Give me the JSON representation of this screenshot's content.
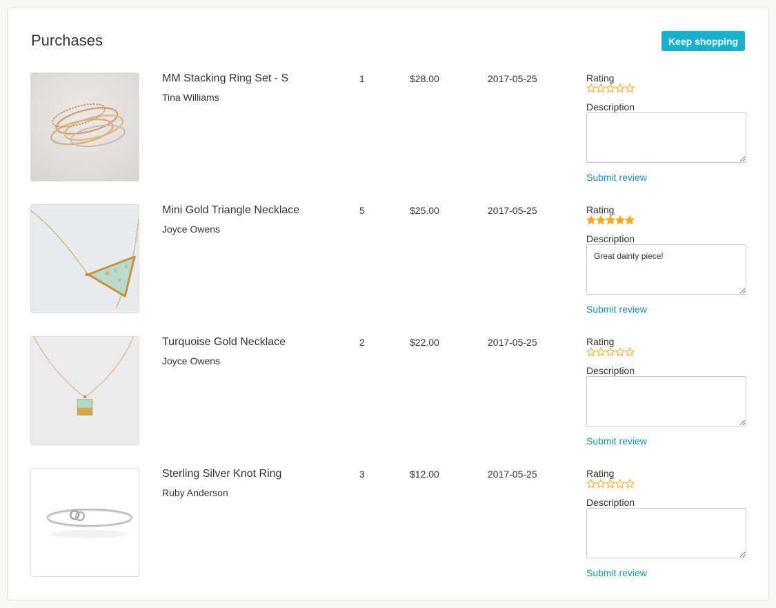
{
  "header": {
    "title": "Purchases",
    "keep_shopping": "Keep shopping"
  },
  "labels": {
    "rating": "Rating",
    "description": "Description",
    "submit": "Submit review"
  },
  "colors": {
    "accent": "#17b0cf",
    "link": "#1a8fb5",
    "star": "#f5a623"
  },
  "purchases": [
    {
      "name": "MM Stacking Ring Set - S",
      "seller": "Tina Williams",
      "qty": "1",
      "price": "$28.00",
      "date": "2017-05-25",
      "rating": 0,
      "description": "",
      "image": "stacking-rings-photo"
    },
    {
      "name": "Mini Gold Triangle Necklace",
      "seller": "Joyce Owens",
      "qty": "5",
      "price": "$25.00",
      "date": "2017-05-25",
      "rating": 5,
      "description": "Great dainty piece!",
      "image": "triangle-necklace-photo"
    },
    {
      "name": "Turquoise Gold Necklace",
      "seller": "Joyce Owens",
      "qty": "2",
      "price": "$22.00",
      "date": "2017-05-25",
      "rating": 0,
      "description": "",
      "image": "turquoise-necklace-photo"
    },
    {
      "name": "Sterling Silver Knot Ring",
      "seller": "Ruby Anderson",
      "qty": "3",
      "price": "$12.00",
      "date": "2017-05-25",
      "rating": 0,
      "description": "",
      "image": "knot-ring-photo"
    }
  ]
}
